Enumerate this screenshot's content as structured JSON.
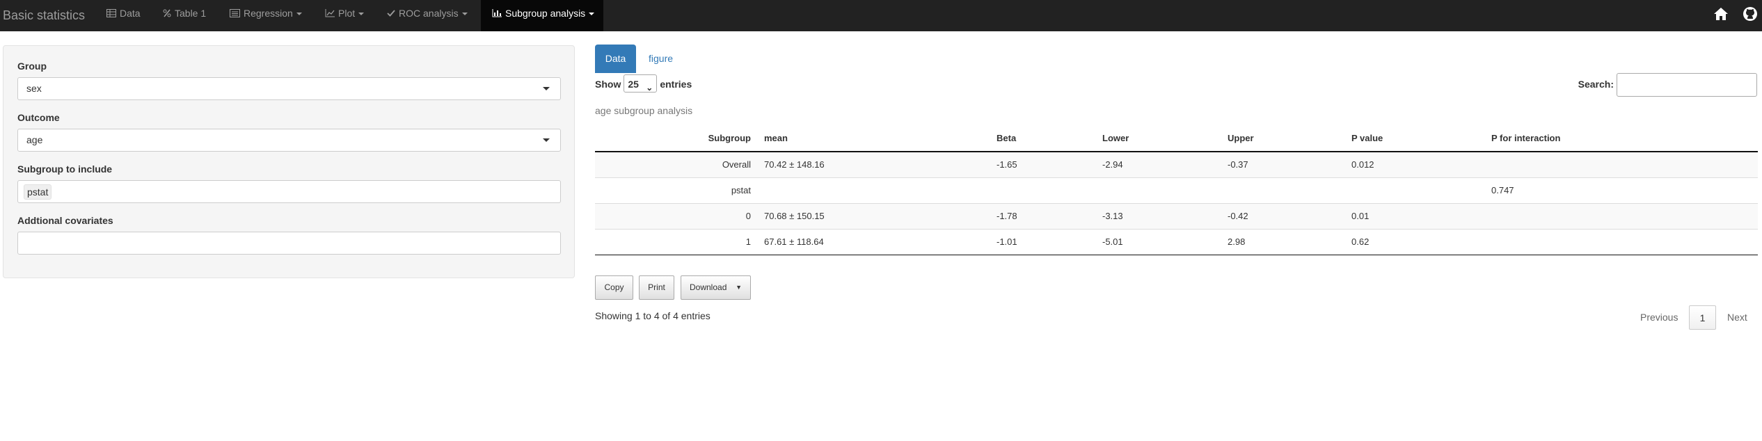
{
  "navbar": {
    "brand": "Basic statistics",
    "items": [
      {
        "label": "Data"
      },
      {
        "label": "Table 1"
      },
      {
        "label": "Regression"
      },
      {
        "label": "Plot"
      },
      {
        "label": "ROC analysis"
      },
      {
        "label": "Subgroup analysis"
      }
    ]
  },
  "form": {
    "group_label": "Group",
    "group_value": "sex",
    "outcome_label": "Outcome",
    "outcome_value": "age",
    "subgroup_label": "Subgroup to include",
    "subgroup_tag": "pstat",
    "covariates_label": "Addtional covariates",
    "covariates_value": ""
  },
  "tabs": [
    {
      "label": "Data"
    },
    {
      "label": "figure"
    }
  ],
  "table_controls": {
    "show_label": "Show",
    "entries_value": "25",
    "entries_label": "entries",
    "search_label": "Search:"
  },
  "caption": "age subgroup analysis",
  "table": {
    "headers": [
      "Subgroup",
      "mean",
      "Beta",
      "Lower",
      "Upper",
      "P value",
      "P for interaction"
    ],
    "rows": [
      [
        "Overall",
        "70.42 ± 148.16",
        "-1.65",
        "-2.94",
        "-0.37",
        "0.012",
        ""
      ],
      [
        "pstat",
        "",
        "",
        "",
        "",
        "",
        "0.747"
      ],
      [
        "0",
        "70.68 ± 150.15",
        "-1.78",
        "-3.13",
        "-0.42",
        "0.01",
        ""
      ],
      [
        "1",
        "67.61 ± 118.64",
        "-1.01",
        "-5.01",
        "2.98",
        "0.62",
        ""
      ]
    ]
  },
  "buttons": {
    "copy": "Copy",
    "print": "Print",
    "download": "Download"
  },
  "info": "Showing 1 to 4 of 4 entries",
  "pagination": {
    "previous": "Previous",
    "current": "1",
    "next": "Next"
  },
  "icons": {
    "home": "home-icon",
    "github": "github-icon"
  }
}
